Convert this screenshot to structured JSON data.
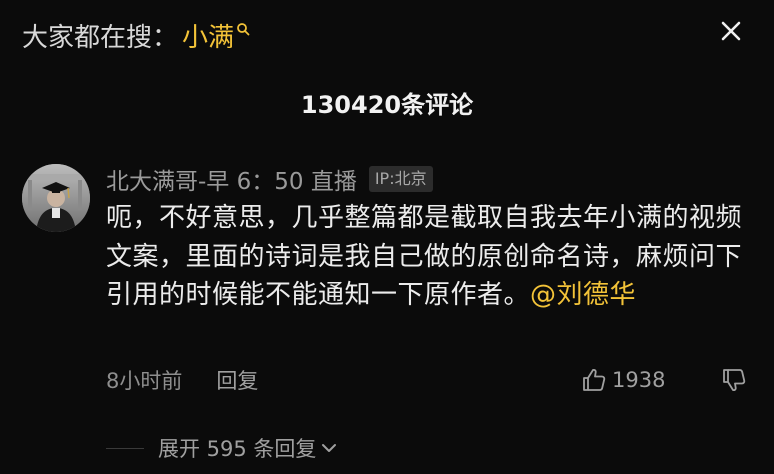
{
  "search": {
    "prefix": "大家都在搜：",
    "keyword": "小满"
  },
  "panel": {
    "comment_count": "130420条评论"
  },
  "comment": {
    "username": "北大满哥-早 6：50 直播",
    "ip_label": "IP:北京",
    "body_text": "呃，不好意思，几乎整篇都是截取自我去年小满的视频文案，里面的诗词是我自己做的原创命名诗，麻烦问下引用的时候能不能通知一下原作者。",
    "mention": "@刘德华",
    "time": "8小时前",
    "reply_label": "回复",
    "like_count": "1938"
  },
  "replies": {
    "expand_label": "展开 595 条回复"
  },
  "colors": {
    "background": "#0b0b0b",
    "accent": "#f3c338",
    "muted_text": "#9a9a9a",
    "body_text": "#ececec"
  },
  "icons": {
    "close": "close-icon",
    "search": "search-icon",
    "like": "thumbs-up-icon",
    "dislike": "thumbs-down-icon",
    "expand": "chevron-down-icon"
  }
}
